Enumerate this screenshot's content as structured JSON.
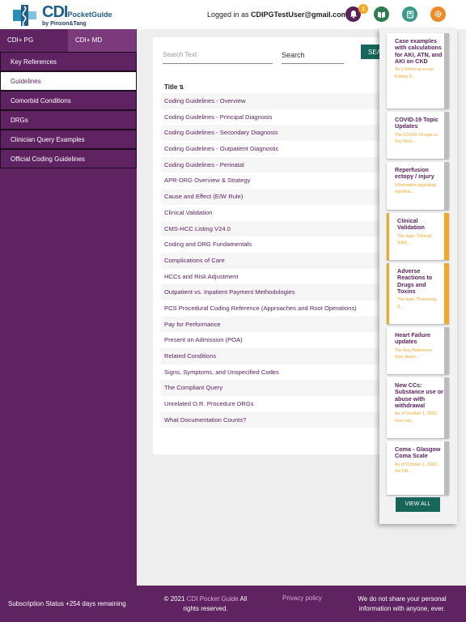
{
  "header": {
    "logo_cdi": "CDI",
    "logo_pocket_guide": "PocketGuide",
    "logo_by": "by Pinson&Tang",
    "logged_in_prefix": "Logged in as ",
    "user_email": "CDIPGTestUser@gmail.com",
    "notification_count": "1",
    "icons": [
      "bell-icon",
      "book-icon",
      "calculator-icon",
      "gear-icon"
    ]
  },
  "sidebar": {
    "tabs": [
      {
        "label": "CDI+ PG"
      },
      {
        "label": "CDI+ MD"
      }
    ],
    "items": [
      {
        "label": "Key References"
      },
      {
        "label": "Guidelines"
      },
      {
        "label": "Comorbid Conditions"
      },
      {
        "label": "DRGs"
      },
      {
        "label": "Clinician Query Examples"
      },
      {
        "label": "Official Coding Guidelines"
      }
    ]
  },
  "main": {
    "search_placeholder": "Search Text",
    "search_selected": "Search",
    "search_button": "SEA",
    "column_header": "Title",
    "rows": [
      "Coding Guidelines - Overview",
      "Coding Guidelines - Principal Diagnosis",
      "Coding Guidelines - Secondary Diagnosis",
      "Coding Guidelines - Outpatient Diagnostic",
      "Coding Guidelines - Perinatal",
      "APR-DRG Overview & Strategy",
      "Cause and Effect (E/W Rule)",
      "Clinical Validation",
      "CMS-HCC Listing V24.0",
      "Coding and DRG Fundamentals",
      "Complications of Care",
      "HCCs and Risk Adjustment",
      "Outpatient vs. Inpatient Payment Methodologies",
      "PCS Procedural Coding Reference (Approaches and Root Operations)",
      "Pay for Performance",
      "Present on Admission (POA)",
      "Related Conditions",
      "Signs, Symptoms, and Unspecified Codes",
      "The Compliant Query",
      "Unrelated O.R. Procedure DRGs",
      "What Documentation Counts?"
    ]
  },
  "notifications": {
    "cards": [
      {
        "title": "Case examples with calculations for AKI, ATN, and AKI on CKD",
        "desc": "As a follow-up to our Kidney D..."
      },
      {
        "title": "COVID-19 Topic Updates",
        "desc": "The COVID-19 topic in Key Refe..."
      },
      {
        "title": "Reperfusion ectopy / injury",
        "desc": "Information regarding reperfus..."
      },
      {
        "title": "Clinical Validation",
        "desc": "The topic \"Clinical Valid..."
      },
      {
        "title": "Adverse Reactions to Drugs and Toxins",
        "desc": "The topic \"Poisoning &..."
      },
      {
        "title": "Heart Failure updates",
        "desc": "The Key Reference topic Heart..."
      },
      {
        "title": "New CCs: Substance use or abuse with withdrawal",
        "desc": "As of October 1, 2020, new cod..."
      },
      {
        "title": "Coma - Glasgow Coma Scale",
        "desc": "As of October 1, 2020, the CB..."
      }
    ],
    "view_all": "VIEW ALL"
  },
  "footer": {
    "subscription": "Subscription Status +254 days remaining",
    "copyright_prefix": "© 2021 ",
    "copyright_link": "CDI Pocket Guide",
    "copyright_suffix": " All rights reserved.",
    "privacy": "Privacy policy",
    "share": "We do not share your personal information with anyone, ever."
  },
  "colors": {
    "brand_purple": "#5e2360",
    "accent_orange": "#f5a623",
    "button_teal": "#17665a"
  }
}
